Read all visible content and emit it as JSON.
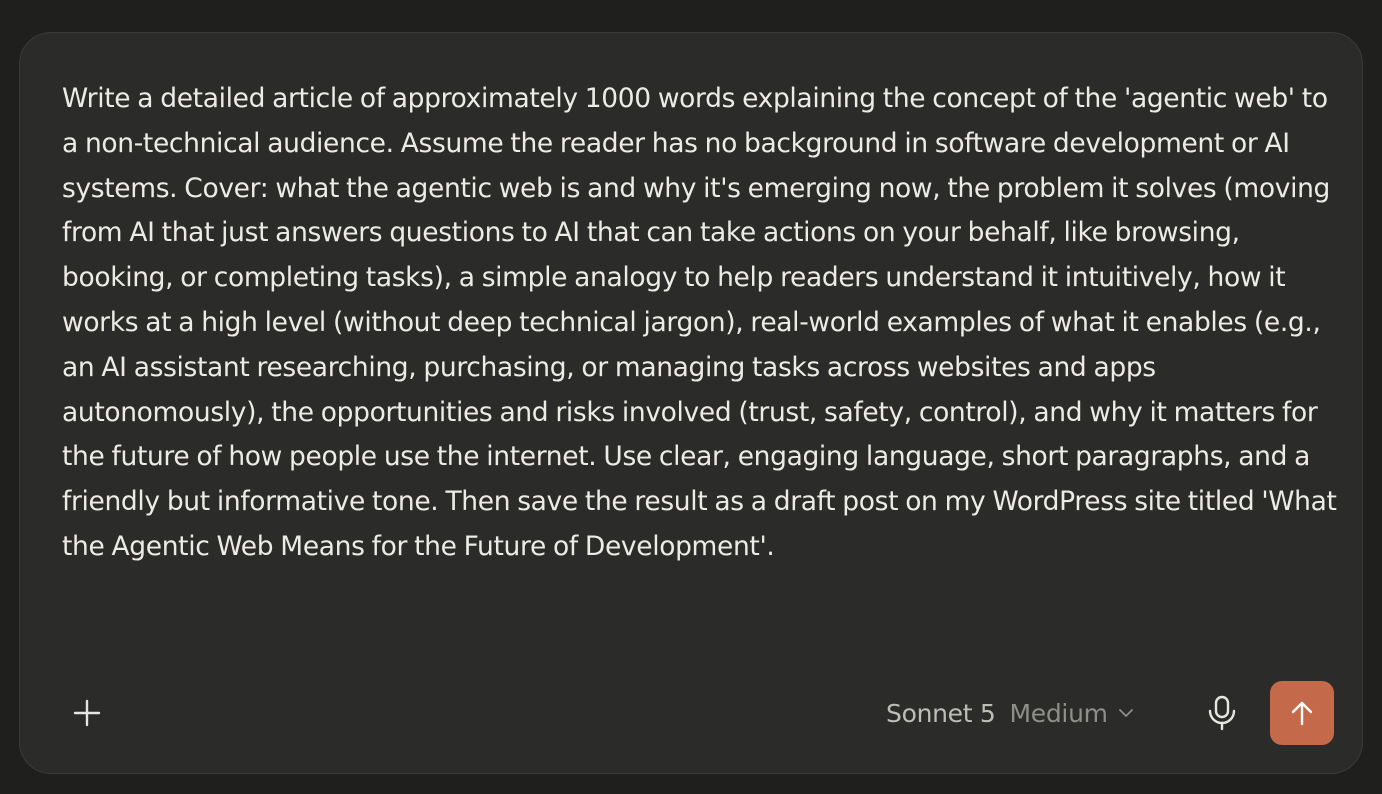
{
  "composer": {
    "prompt_text": "Write a detailed article of approximately 1000 words explaining the concept of the 'agentic web' to a non-technical audience. Assume the reader has no background in software development or AI systems. Cover: what the agentic web is and why it's emerging now, the problem it solves (moving from AI that just answers questions to AI that can take actions on your behalf, like browsing, booking, or completing tasks), a simple analogy to help readers understand it intuitively, how it works at a high level (without deep technical jargon), real-world examples of what it enables (e.g., an AI assistant researching, purchasing, or managing tasks across websites and apps autonomously), the opportunities and risks involved (trust, safety, control), and why it matters for the future of how people use the internet. Use clear, engaging language, short paragraphs, and a friendly but informative tone. Then save the result as a draft post on my WordPress site titled 'What the Agentic Web Means for the Future of Development'.",
    "add_icon": "plus-icon",
    "model": {
      "name": "Sonnet 5",
      "effort": "Medium",
      "dropdown_icon": "chevron-down-icon"
    },
    "mic_icon": "microphone-icon",
    "send_icon": "arrow-up-icon"
  },
  "colors": {
    "background": "#1f1f1e",
    "composer_bg": "#2b2b29",
    "text": "#ecebe6",
    "send_button": "#c4694a"
  }
}
